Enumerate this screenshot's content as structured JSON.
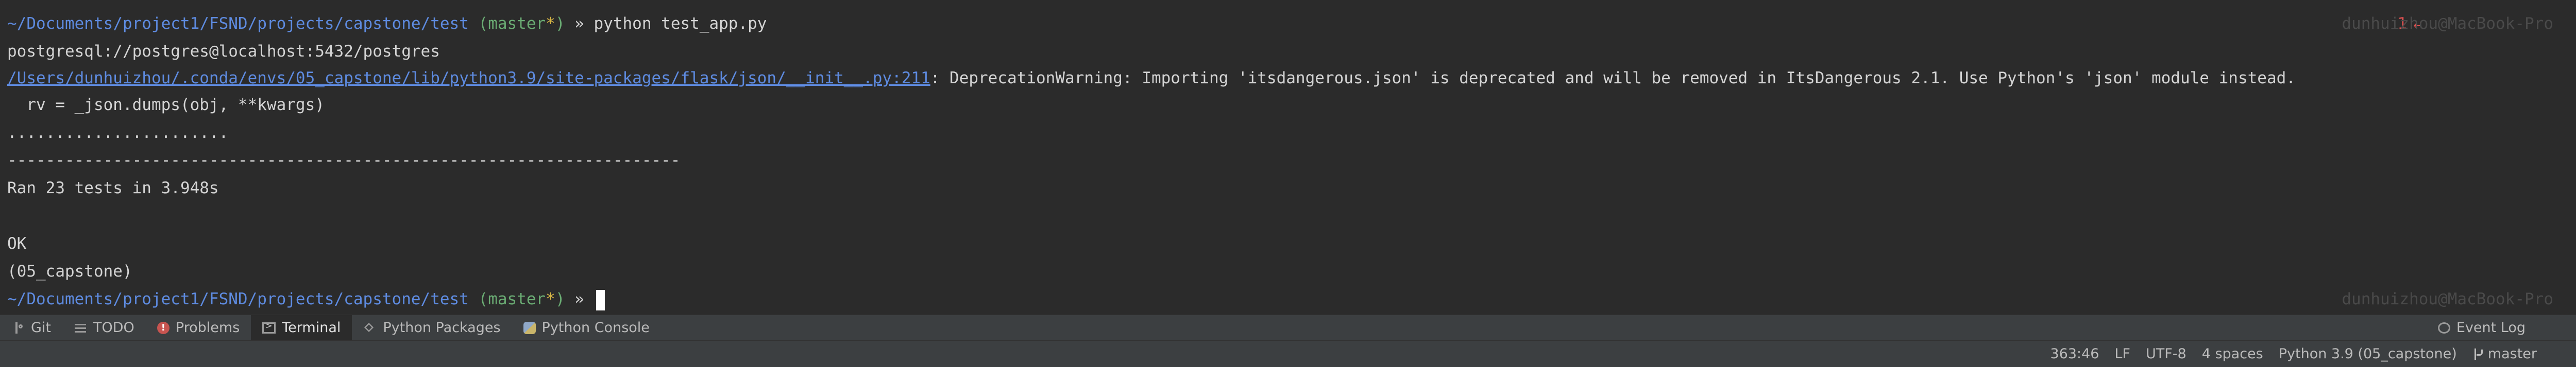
{
  "terminal": {
    "cwd": "~/Documents/project1/FSND/projects/capstone/test",
    "git_branch_open": " (",
    "git_branch": "master",
    "git_dirty": "*",
    "git_branch_close": ")",
    "prompt_symbol": " » ",
    "command": "python test_app.py",
    "exit_code": "1",
    "exit_arrow": "↵",
    "host_ghost": "dunhuizhou@MacBook-Pro",
    "output": {
      "db_url": "postgresql://postgres@localhost:5432/postgres",
      "warning_file_link": "/Users/dunhuizhou/.conda/envs/05_capstone/lib/python3.9/site-packages/flask/json/__init__.py:211",
      "warning_message": ": DeprecationWarning: Importing 'itsdangerous.json' is deprecated and will be removed in ItsDangerous 2.1. Use Python's 'json' module instead.",
      "warning_source": "  rv = _json.dumps(obj, **kwargs)",
      "dots": ".......................",
      "separator": "----------------------------------------------------------------------",
      "summary": "Ran 23 tests in 3.948s",
      "result": "OK",
      "env": "(05_capstone)"
    }
  },
  "tool_window_bar": {
    "tabs": [
      {
        "label": "Git",
        "icon": "git-icon"
      },
      {
        "label": "TODO",
        "icon": "todo-icon"
      },
      {
        "label": "Problems",
        "icon": "problems-icon",
        "icon_glyph": "!"
      },
      {
        "label": "Terminal",
        "icon": "terminal-icon"
      },
      {
        "label": "Python Packages",
        "icon": "layers-icon"
      },
      {
        "label": "Python Console",
        "icon": "python-icon"
      }
    ],
    "active_tab": "Terminal",
    "event_log": "Event Log"
  },
  "status_bar": {
    "position": "363:46",
    "line_separator": "LF",
    "encoding": "UTF-8",
    "indent": "4 spaces",
    "interpreter": "Python 3.9 (05_capstone)",
    "branch": "master"
  }
}
